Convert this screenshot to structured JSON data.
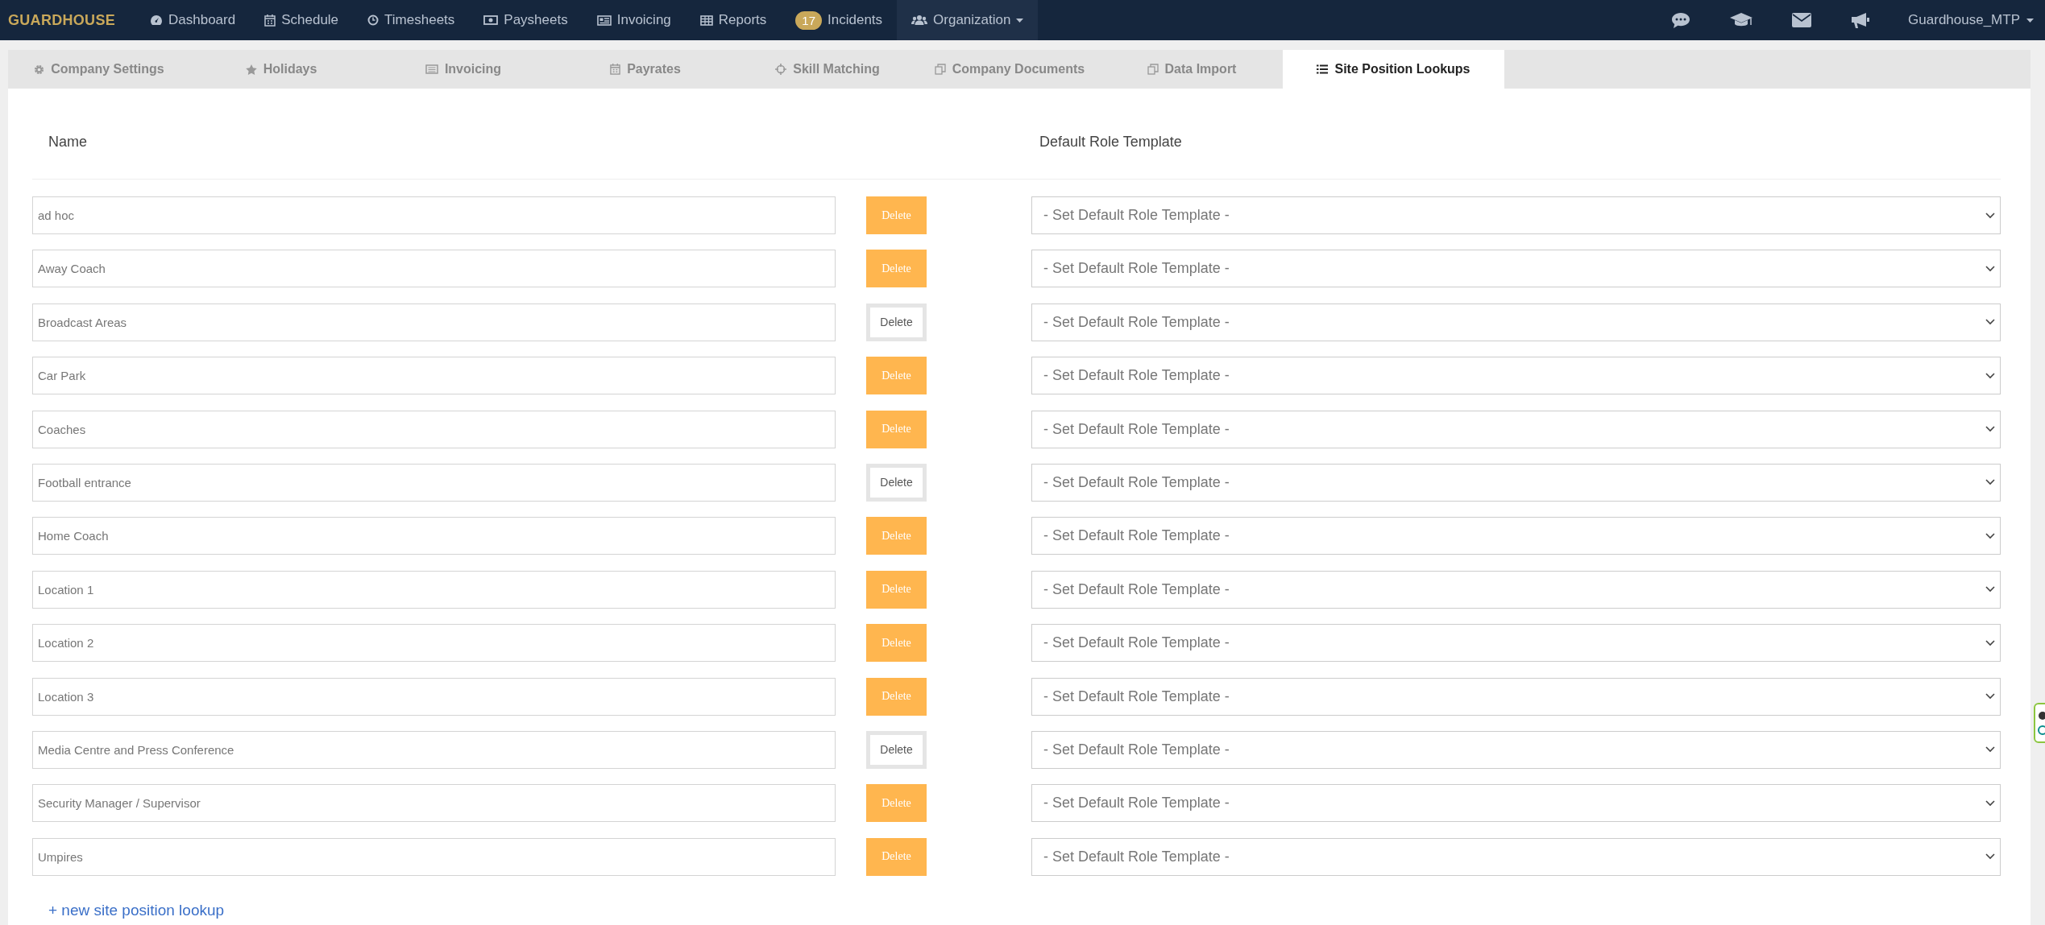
{
  "navbar": {
    "brand": "GUARDHOUSE",
    "items": [
      {
        "label": "Dashboard",
        "selected": false
      },
      {
        "label": "Schedule",
        "selected": false
      },
      {
        "label": "Timesheets",
        "selected": false
      },
      {
        "label": "Paysheets",
        "selected": false
      },
      {
        "label": "Invoicing",
        "selected": false
      },
      {
        "label": "Reports",
        "selected": false
      },
      {
        "label": "Incidents",
        "badge": "17",
        "selected": false
      },
      {
        "label": "Organization",
        "selected": true
      }
    ],
    "user": "Guardhouse_MTP"
  },
  "tabs": [
    {
      "label": "Company Settings",
      "selected": false
    },
    {
      "label": "Holidays",
      "selected": false
    },
    {
      "label": "Invoicing",
      "selected": false
    },
    {
      "label": "Payrates",
      "selected": false
    },
    {
      "label": "Skill Matching",
      "selected": false
    },
    {
      "label": "Company Documents",
      "selected": false
    },
    {
      "label": "Data Import",
      "selected": false
    },
    {
      "label": "Site Position Lookups",
      "selected": true
    }
  ],
  "table": {
    "columns": [
      "Name",
      "Default Role Template"
    ],
    "rows": [
      {
        "name": "ad hoc",
        "delete": {
          "label": "Delete",
          "kind": "warning"
        },
        "role_template": "- Set Default Role Template -"
      },
      {
        "name": "Away Coach",
        "delete": {
          "label": "Delete",
          "kind": "warning"
        },
        "role_template": "- Set Default Role Template -"
      },
      {
        "name": "Broadcast Areas",
        "delete": {
          "label": "Delete",
          "kind": "default"
        },
        "role_template": "- Set Default Role Template -"
      },
      {
        "name": "Car Park",
        "delete": {
          "label": "Delete",
          "kind": "warning"
        },
        "role_template": "- Set Default Role Template -"
      },
      {
        "name": "Coaches",
        "delete": {
          "label": "Delete",
          "kind": "warning"
        },
        "role_template": "- Set Default Role Template -"
      },
      {
        "name": "Football entrance",
        "delete": {
          "label": "Delete",
          "kind": "default"
        },
        "role_template": "- Set Default Role Template -"
      },
      {
        "name": "Home Coach",
        "delete": {
          "label": "Delete",
          "kind": "warning"
        },
        "role_template": "- Set Default Role Template -"
      },
      {
        "name": "Location 1",
        "delete": {
          "label": "Delete",
          "kind": "warning"
        },
        "role_template": "- Set Default Role Template -"
      },
      {
        "name": "Location 2",
        "delete": {
          "label": "Delete",
          "kind": "warning"
        },
        "role_template": "- Set Default Role Template -"
      },
      {
        "name": "Location 3",
        "delete": {
          "label": "Delete",
          "kind": "warning"
        },
        "role_template": "- Set Default Role Template -"
      },
      {
        "name": "Media Centre and Press Conference",
        "delete": {
          "label": "Delete",
          "kind": "default"
        },
        "role_template": "- Set Default Role Template -"
      },
      {
        "name": "Security Manager / Supervisor",
        "delete": {
          "label": "Delete",
          "kind": "warning"
        },
        "role_template": "- Set Default Role Template -"
      },
      {
        "name": "Umpires",
        "delete": {
          "label": "Delete",
          "kind": "warning"
        },
        "role_template": "- Set Default Role Template -"
      }
    ]
  },
  "add_link": "+ new site position lookup"
}
